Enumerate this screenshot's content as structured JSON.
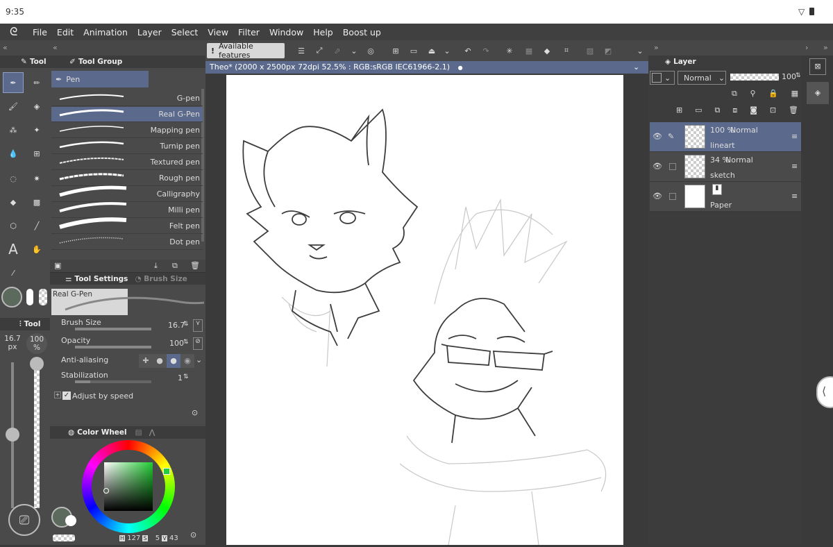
{
  "status": {
    "time": "9:35"
  },
  "menu": [
    "File",
    "Edit",
    "Animation",
    "Layer",
    "Select",
    "View",
    "Filter",
    "Window",
    "Help",
    "Boost up"
  ],
  "toolbar": {
    "features_label": "Available features"
  },
  "document": {
    "tab_title": "Theo* (2000 x 2500px 72dpi 52.5% : RGB:sRGB IEC61966-2.1)"
  },
  "tool_panel": {
    "title": "Tool"
  },
  "tool_group": {
    "title": "Tool Group",
    "selected_group": "Pen",
    "brushes": [
      "G-pen",
      "Real G-Pen",
      "Mapping pen",
      "Turnip pen",
      "Textured pen",
      "Rough pen",
      "Calligraphy",
      "Milli pen",
      "Felt pen",
      "Dot pen"
    ],
    "selected_brush": "Real G-Pen"
  },
  "tool_settings": {
    "title": "Tool Settings",
    "tab2": "Brush Size",
    "preview_label": "Real G-Pen",
    "brush_size_label": "Brush Size",
    "brush_size_value": "16.7",
    "opacity_label": "Opacity",
    "opacity_value": "100",
    "anti_alias_label": "Anti-aliasing",
    "stabilization_label": "Stabilization",
    "stabilization_value": "1",
    "adjust_label": "Adjust by speed"
  },
  "small_tool": {
    "title": "Tool",
    "size_value": "16.7",
    "size_unit": "px",
    "opacity_value": "100",
    "opacity_unit": "%"
  },
  "color_panel": {
    "title": "Color Wheel",
    "h_value": "127",
    "s_value": "5",
    "v_value": "43",
    "h_label": "H",
    "s_label": "S",
    "v_label": "V"
  },
  "layer_panel": {
    "title": "Layer",
    "blend_mode": "Normal",
    "opacity": "100",
    "layers": [
      {
        "percent": "100 %",
        "mode": "Normal",
        "name": "lineart"
      },
      {
        "percent": "34 %",
        "mode": "Normal",
        "name": "sketch"
      },
      {
        "name": "Paper"
      }
    ]
  },
  "colors": {
    "accent": "#5b6a8c",
    "current_color": "#5c6a5e"
  }
}
